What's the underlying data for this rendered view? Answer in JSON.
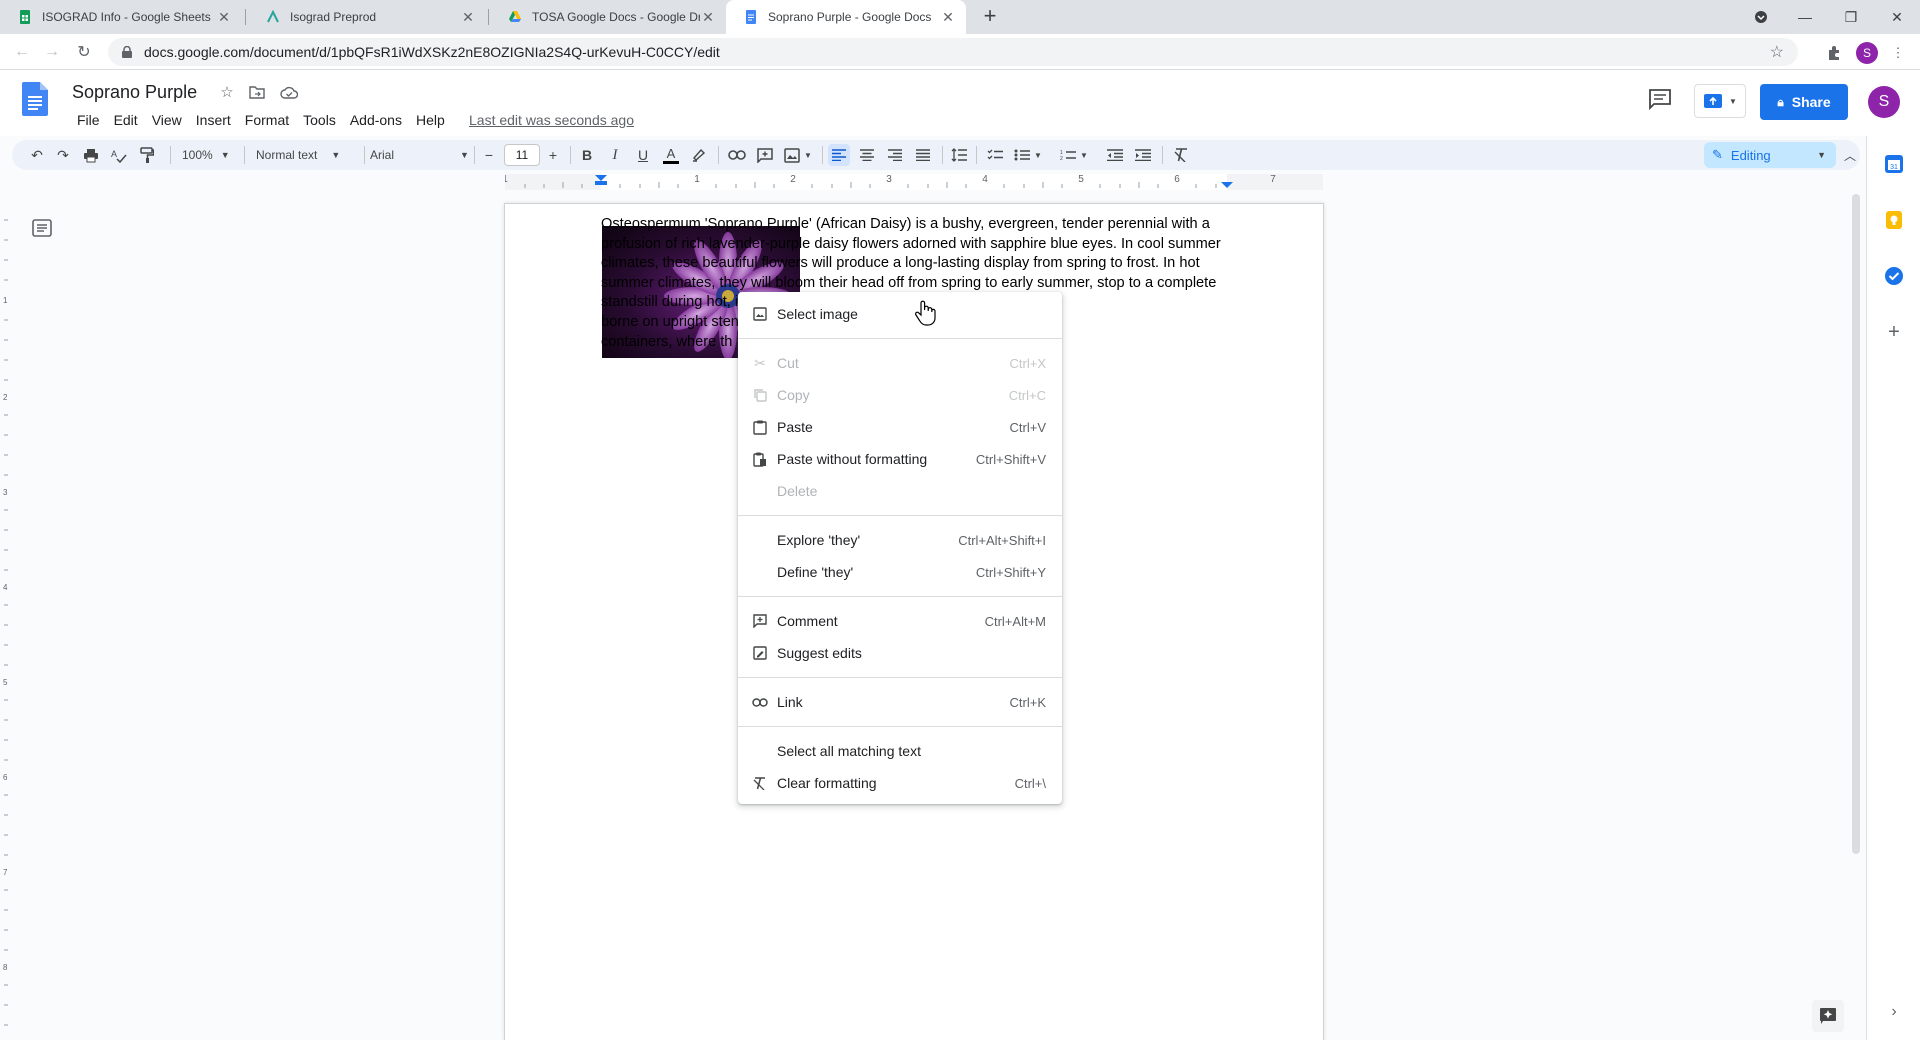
{
  "browser": {
    "tabs": [
      {
        "title": "ISOGRAD Info - Google Sheets",
        "active": false,
        "favicon": "sheets-icon"
      },
      {
        "title": "Isograd Preprod",
        "active": false,
        "favicon": "isograd-icon"
      },
      {
        "title": "TOSA Google Docs - Google Driv",
        "active": false,
        "favicon": "drive-icon"
      },
      {
        "title": "Soprano Purple - Google Docs",
        "active": true,
        "favicon": "docs-icon"
      }
    ],
    "url": "docs.google.com/document/d/1pbQFsR1iWdXSKz2nE8OZIGNIa2S4Q-urKevuH-C0CCY/edit",
    "profile_initial": "S"
  },
  "doc": {
    "title": "Soprano Purple",
    "menu": [
      "File",
      "Edit",
      "View",
      "Insert",
      "Format",
      "Tools",
      "Add-ons",
      "Help"
    ],
    "last_edit": "Last edit was seconds ago",
    "share_label": "Share",
    "avatar_initial": "S"
  },
  "toolbar": {
    "zoom": "100%",
    "style": "Normal text",
    "font": "Arial",
    "font_size": "11",
    "mode": "Editing"
  },
  "ruler": {
    "marks": [
      "1",
      "1",
      "2",
      "3",
      "4",
      "5",
      "6",
      "7"
    ],
    "v_marks": [
      "1",
      "2",
      "3",
      "4",
      "5",
      "6",
      "7",
      "8"
    ]
  },
  "body_lines": [
    "Osteospermum 'Soprano Purple' (African Daisy) is a bushy, evergreen, tender perennial with a",
    "profusion of rich lavender-purple daisy flowers adorned with sapphire blue eyes. In cool summer",
    "climates, these beautiful flowers will produce a long-lasting display from spring to frost. In hot",
    "summer climates, they will bloom their head off from spring to early summer, stop to a complete",
    "standstill during hot,                                          ie fall. The blossoms are",
    "borne on upright sten                                          nny borders and",
    "containers, where th"
  ],
  "context_menu": {
    "items": [
      {
        "label": "Select image",
        "shortcut": "",
        "icon": "image-icon",
        "disabled": false
      },
      {
        "sep": true
      },
      {
        "label": "Cut",
        "shortcut": "Ctrl+X",
        "icon": "scissors-icon",
        "disabled": true
      },
      {
        "label": "Copy",
        "shortcut": "Ctrl+C",
        "icon": "copy-icon",
        "disabled": true
      },
      {
        "label": "Paste",
        "shortcut": "Ctrl+V",
        "icon": "clipboard-icon",
        "disabled": false
      },
      {
        "label": "Paste without formatting",
        "shortcut": "Ctrl+Shift+V",
        "icon": "paste-plain-icon",
        "disabled": false
      },
      {
        "label": "Delete",
        "shortcut": "",
        "icon": "",
        "disabled": true
      },
      {
        "sep": true
      },
      {
        "label": "Explore 'they'",
        "shortcut": "Ctrl+Alt+Shift+I",
        "icon": "",
        "disabled": false
      },
      {
        "label": "Define 'they'",
        "shortcut": "Ctrl+Shift+Y",
        "icon": "",
        "disabled": false
      },
      {
        "sep": true
      },
      {
        "label": "Comment",
        "shortcut": "Ctrl+Alt+M",
        "icon": "comment-add-icon",
        "disabled": false
      },
      {
        "label": "Suggest edits",
        "shortcut": "",
        "icon": "suggest-edits-icon",
        "disabled": false
      },
      {
        "sep": true
      },
      {
        "label": "Link",
        "shortcut": "Ctrl+K",
        "icon": "link-icon",
        "disabled": false
      },
      {
        "sep": true
      },
      {
        "label": "Select all matching text",
        "shortcut": "",
        "icon": "",
        "disabled": false
      },
      {
        "label": "Clear formatting",
        "shortcut": "Ctrl+\\",
        "icon": "clear-format-icon",
        "disabled": false
      }
    ]
  },
  "colors": {
    "accent": "#1a73e8",
    "avatar": "#8e24aa",
    "flower": "#8e3fa6"
  }
}
